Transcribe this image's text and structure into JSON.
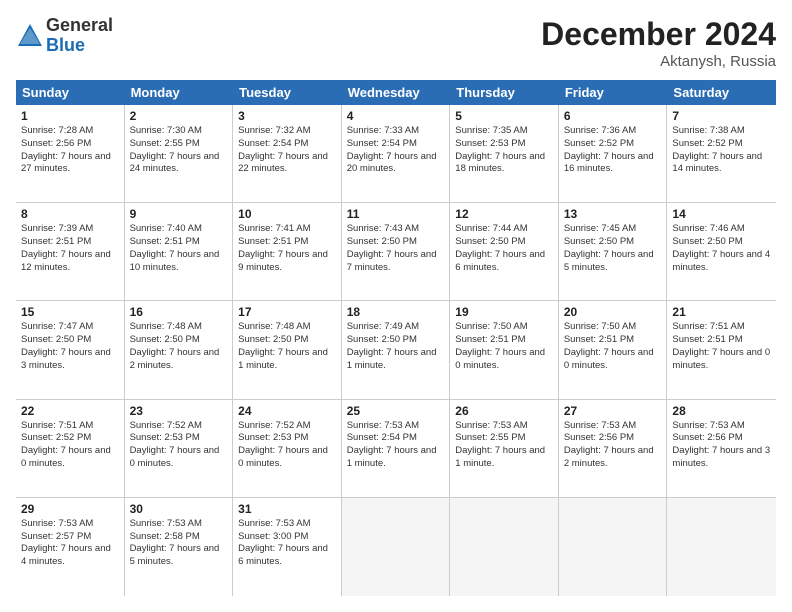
{
  "logo": {
    "general": "General",
    "blue": "Blue"
  },
  "title": "December 2024",
  "location": "Aktanysh, Russia",
  "days": [
    "Sunday",
    "Monday",
    "Tuesday",
    "Wednesday",
    "Thursday",
    "Friday",
    "Saturday"
  ],
  "weeks": [
    [
      {
        "day": "1",
        "sunrise": "Sunrise: 7:28 AM",
        "sunset": "Sunset: 2:56 PM",
        "daylight": "Daylight: 7 hours and 27 minutes."
      },
      {
        "day": "2",
        "sunrise": "Sunrise: 7:30 AM",
        "sunset": "Sunset: 2:55 PM",
        "daylight": "Daylight: 7 hours and 24 minutes."
      },
      {
        "day": "3",
        "sunrise": "Sunrise: 7:32 AM",
        "sunset": "Sunset: 2:54 PM",
        "daylight": "Daylight: 7 hours and 22 minutes."
      },
      {
        "day": "4",
        "sunrise": "Sunrise: 7:33 AM",
        "sunset": "Sunset: 2:54 PM",
        "daylight": "Daylight: 7 hours and 20 minutes."
      },
      {
        "day": "5",
        "sunrise": "Sunrise: 7:35 AM",
        "sunset": "Sunset: 2:53 PM",
        "daylight": "Daylight: 7 hours and 18 minutes."
      },
      {
        "day": "6",
        "sunrise": "Sunrise: 7:36 AM",
        "sunset": "Sunset: 2:52 PM",
        "daylight": "Daylight: 7 hours and 16 minutes."
      },
      {
        "day": "7",
        "sunrise": "Sunrise: 7:38 AM",
        "sunset": "Sunset: 2:52 PM",
        "daylight": "Daylight: 7 hours and 14 minutes."
      }
    ],
    [
      {
        "day": "8",
        "sunrise": "Sunrise: 7:39 AM",
        "sunset": "Sunset: 2:51 PM",
        "daylight": "Daylight: 7 hours and 12 minutes."
      },
      {
        "day": "9",
        "sunrise": "Sunrise: 7:40 AM",
        "sunset": "Sunset: 2:51 PM",
        "daylight": "Daylight: 7 hours and 10 minutes."
      },
      {
        "day": "10",
        "sunrise": "Sunrise: 7:41 AM",
        "sunset": "Sunset: 2:51 PM",
        "daylight": "Daylight: 7 hours and 9 minutes."
      },
      {
        "day": "11",
        "sunrise": "Sunrise: 7:43 AM",
        "sunset": "Sunset: 2:50 PM",
        "daylight": "Daylight: 7 hours and 7 minutes."
      },
      {
        "day": "12",
        "sunrise": "Sunrise: 7:44 AM",
        "sunset": "Sunset: 2:50 PM",
        "daylight": "Daylight: 7 hours and 6 minutes."
      },
      {
        "day": "13",
        "sunrise": "Sunrise: 7:45 AM",
        "sunset": "Sunset: 2:50 PM",
        "daylight": "Daylight: 7 hours and 5 minutes."
      },
      {
        "day": "14",
        "sunrise": "Sunrise: 7:46 AM",
        "sunset": "Sunset: 2:50 PM",
        "daylight": "Daylight: 7 hours and 4 minutes."
      }
    ],
    [
      {
        "day": "15",
        "sunrise": "Sunrise: 7:47 AM",
        "sunset": "Sunset: 2:50 PM",
        "daylight": "Daylight: 7 hours and 3 minutes."
      },
      {
        "day": "16",
        "sunrise": "Sunrise: 7:48 AM",
        "sunset": "Sunset: 2:50 PM",
        "daylight": "Daylight: 7 hours and 2 minutes."
      },
      {
        "day": "17",
        "sunrise": "Sunrise: 7:48 AM",
        "sunset": "Sunset: 2:50 PM",
        "daylight": "Daylight: 7 hours and 1 minute."
      },
      {
        "day": "18",
        "sunrise": "Sunrise: 7:49 AM",
        "sunset": "Sunset: 2:50 PM",
        "daylight": "Daylight: 7 hours and 1 minute."
      },
      {
        "day": "19",
        "sunrise": "Sunrise: 7:50 AM",
        "sunset": "Sunset: 2:51 PM",
        "daylight": "Daylight: 7 hours and 0 minutes."
      },
      {
        "day": "20",
        "sunrise": "Sunrise: 7:50 AM",
        "sunset": "Sunset: 2:51 PM",
        "daylight": "Daylight: 7 hours and 0 minutes."
      },
      {
        "day": "21",
        "sunrise": "Sunrise: 7:51 AM",
        "sunset": "Sunset: 2:51 PM",
        "daylight": "Daylight: 7 hours and 0 minutes."
      }
    ],
    [
      {
        "day": "22",
        "sunrise": "Sunrise: 7:51 AM",
        "sunset": "Sunset: 2:52 PM",
        "daylight": "Daylight: 7 hours and 0 minutes."
      },
      {
        "day": "23",
        "sunrise": "Sunrise: 7:52 AM",
        "sunset": "Sunset: 2:53 PM",
        "daylight": "Daylight: 7 hours and 0 minutes."
      },
      {
        "day": "24",
        "sunrise": "Sunrise: 7:52 AM",
        "sunset": "Sunset: 2:53 PM",
        "daylight": "Daylight: 7 hours and 0 minutes."
      },
      {
        "day": "25",
        "sunrise": "Sunrise: 7:53 AM",
        "sunset": "Sunset: 2:54 PM",
        "daylight": "Daylight: 7 hours and 1 minute."
      },
      {
        "day": "26",
        "sunrise": "Sunrise: 7:53 AM",
        "sunset": "Sunset: 2:55 PM",
        "daylight": "Daylight: 7 hours and 1 minute."
      },
      {
        "day": "27",
        "sunrise": "Sunrise: 7:53 AM",
        "sunset": "Sunset: 2:56 PM",
        "daylight": "Daylight: 7 hours and 2 minutes."
      },
      {
        "day": "28",
        "sunrise": "Sunrise: 7:53 AM",
        "sunset": "Sunset: 2:56 PM",
        "daylight": "Daylight: 7 hours and 3 minutes."
      }
    ],
    [
      {
        "day": "29",
        "sunrise": "Sunrise: 7:53 AM",
        "sunset": "Sunset: 2:57 PM",
        "daylight": "Daylight: 7 hours and 4 minutes."
      },
      {
        "day": "30",
        "sunrise": "Sunrise: 7:53 AM",
        "sunset": "Sunset: 2:58 PM",
        "daylight": "Daylight: 7 hours and 5 minutes."
      },
      {
        "day": "31",
        "sunrise": "Sunrise: 7:53 AM",
        "sunset": "Sunset: 3:00 PM",
        "daylight": "Daylight: 7 hours and 6 minutes."
      },
      null,
      null,
      null,
      null
    ]
  ]
}
